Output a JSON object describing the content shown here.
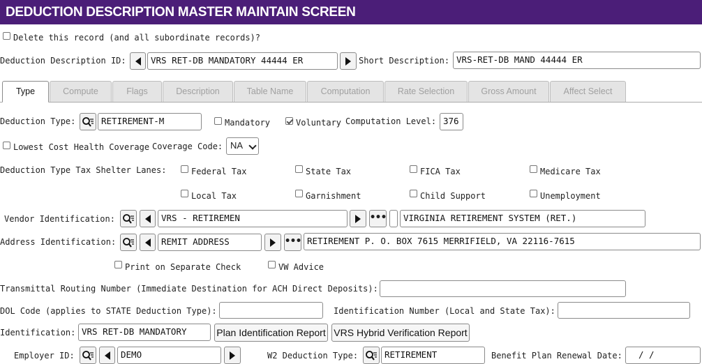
{
  "title": "DEDUCTION DESCRIPTION MASTER MAINTAIN SCREEN",
  "delete_record": {
    "label": "Delete this record (and all subordinate records)?",
    "checked": false
  },
  "deduction_id": {
    "label": "Deduction Description ID:",
    "value": "VRS RET-DB MANDATORY 44444 ER"
  },
  "short_description": {
    "label": "Short Description:",
    "value": "VRS-RET-DB MAND 44444 ER"
  },
  "tabs": [
    {
      "label": "Type",
      "active": true
    },
    {
      "label": "Compute",
      "active": false
    },
    {
      "label": "Flags",
      "active": false
    },
    {
      "label": "Description",
      "active": false
    },
    {
      "label": "Table Name",
      "active": false
    },
    {
      "label": "Computation",
      "active": false
    },
    {
      "label": "Rate Selection",
      "active": false
    },
    {
      "label": "Gross Amount",
      "active": false
    },
    {
      "label": "Affect Select",
      "active": false
    }
  ],
  "deduction_type": {
    "label": "Deduction Type:",
    "value": "RETIREMENT-M"
  },
  "mandatory": {
    "label": "Mandatory",
    "checked": false
  },
  "voluntary": {
    "label": "Voluntary",
    "checked": true
  },
  "computation_level": {
    "label": "Computation Level:",
    "value": "376"
  },
  "lowest_cost": {
    "label": "Lowest Cost Health Coverage",
    "checked": false
  },
  "coverage_code": {
    "label": "Coverage Code:",
    "value": "NA"
  },
  "tax_shelter": {
    "label": "Deduction Type Tax Shelter Lanes:",
    "items": [
      {
        "label": "Federal Tax",
        "checked": false
      },
      {
        "label": "State Tax",
        "checked": false
      },
      {
        "label": "FICA Tax",
        "checked": false
      },
      {
        "label": "Medicare Tax",
        "checked": false
      },
      {
        "label": "Local Tax",
        "checked": false
      },
      {
        "label": "Garnishment",
        "checked": false
      },
      {
        "label": "Child Support",
        "checked": false
      },
      {
        "label": "Unemployment",
        "checked": false
      }
    ]
  },
  "vendor": {
    "label": "Vendor Identification:",
    "value": "VRS - RETIREMEN",
    "name": "VIRGINIA RETIREMENT SYSTEM (RET.)"
  },
  "address": {
    "label": "Address Identification:",
    "value": "REMIT ADDRESS",
    "text": "RETIREMENT P. O. BOX 7615 MERRIFIELD, VA  22116-7615"
  },
  "print_separate": {
    "label": "Print on Separate Check",
    "checked": false
  },
  "vw_advice": {
    "label": "VW Advice",
    "checked": false
  },
  "transmittal": {
    "label": "Transmittal Routing Number (Immediate Destination for ACH Direct Deposits):",
    "value": ""
  },
  "dol_code": {
    "label": "DOL Code (applies to STATE Deduction Type):",
    "value": ""
  },
  "identification_number": {
    "label": "Identification Number (Local and State Tax):",
    "value": ""
  },
  "identification": {
    "label": "Identification:",
    "value": "VRS RET-DB MANDATORY"
  },
  "plan_report_button": "Plan Identification Report",
  "hybrid_report_button": "VRS Hybrid Verification Report",
  "employer": {
    "label": "Employer ID:",
    "value": "DEMO"
  },
  "w2_type": {
    "label": "W2 Deduction Type:",
    "value": "RETIREMENT"
  },
  "renewal": {
    "label": "Benefit Plan Renewal Date:",
    "value": " /  /"
  },
  "colors": {
    "title_bg": "#4b1e78",
    "title_fg": "#ffffff",
    "tab_inactive": "#e4e4e4"
  }
}
